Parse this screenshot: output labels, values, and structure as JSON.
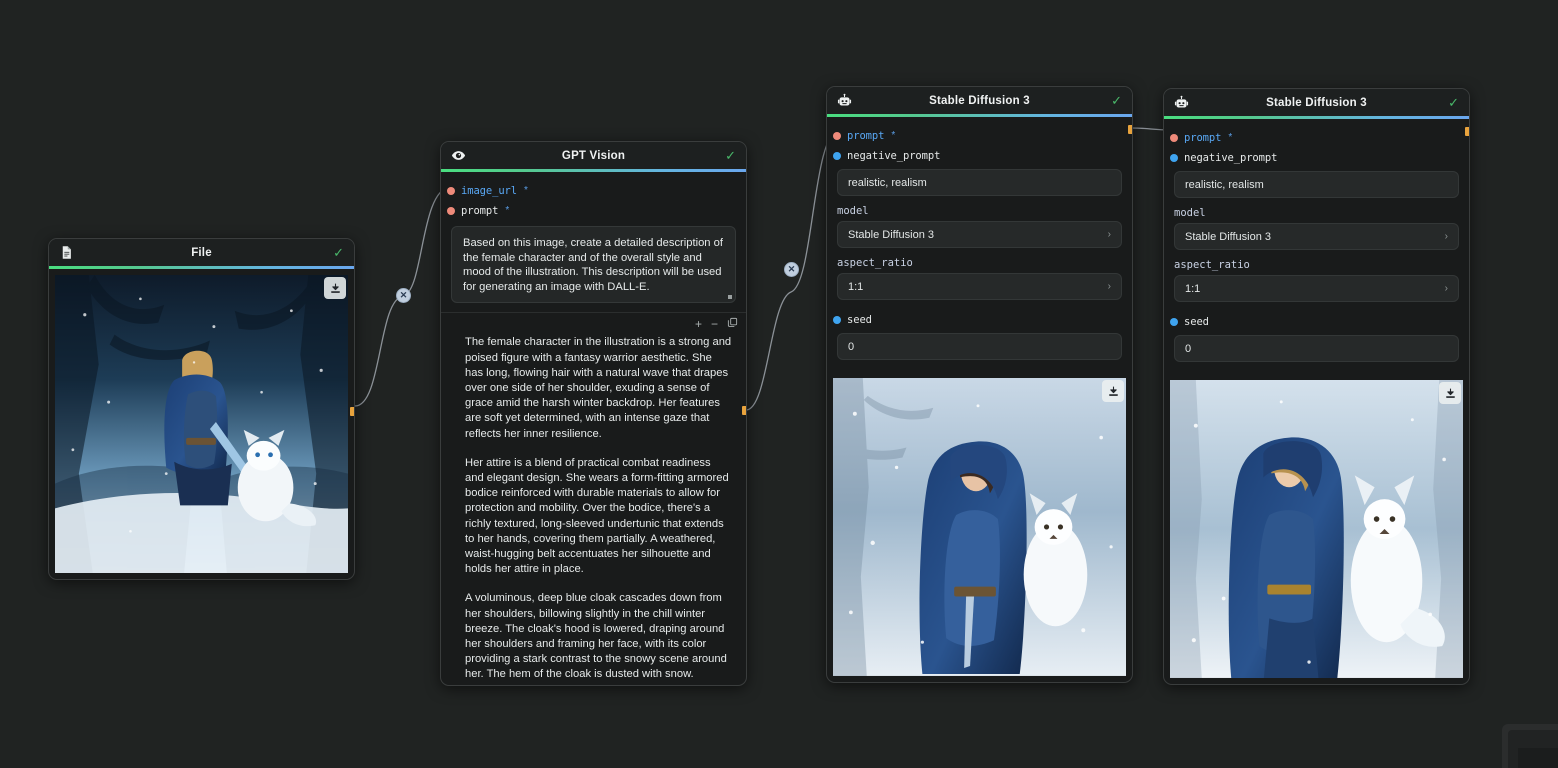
{
  "app": {
    "background_color": "#202322",
    "accent_orange": "#e8a33d",
    "rule_gradient": [
      "#4ade80",
      "#6aa7ee"
    ]
  },
  "nodes": [
    {
      "id": "file",
      "title": "File",
      "icon": "document-icon",
      "status_icon": "check-icon",
      "image_alt": "Fantasy warrior woman in blue cloak with white fox in snowy forest",
      "download_label": "download-icon"
    },
    {
      "id": "gpt_vision",
      "title": "GPT Vision",
      "icon": "eye-icon",
      "status_icon": "check-icon",
      "ports": [
        {
          "name": "image_url",
          "required": true,
          "kind": "required"
        },
        {
          "name": "prompt",
          "required": true,
          "kind": "required"
        }
      ],
      "prompt_value": "Based on this image, create a detailed description of the female character and of the overall style and mood of the illustration. This description will be used for generating an image with DALL-E.",
      "output_tools": [
        "plus-icon",
        "minus-icon",
        "copy-icon"
      ],
      "output_paragraphs": [
        "The female character in the illustration is a strong and poised figure with a fantasy warrior aesthetic. She has long, flowing hair with a natural wave that drapes over one side of her shoulder, exuding a sense of grace amid the harsh winter backdrop. Her features are soft yet determined, with an intense gaze that reflects her inner resilience.",
        "Her attire is a blend of practical combat readiness and elegant design. She wears a form-fitting armored bodice reinforced with durable materials to allow for protection and mobility. Over the bodice, there's a richly textured, long-sleeved undertunic that extends to her hands, covering them partially. A weathered, waist-hugging belt accentuates her silhouette and holds her attire in place.",
        "A voluminous, deep blue cloak cascades down from her shoulders, billowing slightly in the chill winter breeze. The cloak's hood is lowered, draping around her shoulders and framing her face, with its color providing a stark contrast to the snowy scene around her. The hem of the cloak is dusted with snow."
      ]
    },
    {
      "id": "sd3_left",
      "title": "Stable Diffusion 3",
      "icon": "robot-icon",
      "status_icon": "check-icon",
      "ports": [
        {
          "name": "prompt",
          "required": true,
          "kind": "required"
        },
        {
          "name": "negative_prompt",
          "required": false,
          "kind": "optional"
        }
      ],
      "negative_prompt_value": "realistic, realism",
      "fields": [
        {
          "label": "model",
          "value": "Stable Diffusion 3",
          "type": "select"
        },
        {
          "label": "aspect_ratio",
          "value": "1:1",
          "type": "select"
        }
      ],
      "seed_port": {
        "name": "seed",
        "kind": "optional"
      },
      "seed_value": "0",
      "image_alt": "Generated image: dark-haired woman in blue hooded cloak with white fox in snow",
      "download_label": "download-icon"
    },
    {
      "id": "sd3_right",
      "title": "Stable Diffusion 3",
      "icon": "robot-icon",
      "status_icon": "check-icon",
      "ports": [
        {
          "name": "prompt",
          "required": true,
          "kind": "required"
        },
        {
          "name": "negative_prompt",
          "required": false,
          "kind": "optional"
        }
      ],
      "negative_prompt_value": "realistic, realism",
      "fields": [
        {
          "label": "model",
          "value": "Stable Diffusion 3",
          "type": "select"
        },
        {
          "label": "aspect_ratio",
          "value": "1:1",
          "type": "select"
        }
      ],
      "seed_port": {
        "name": "seed",
        "kind": "optional"
      },
      "seed_value": "0",
      "image_alt": "Generated image: blonde woman in blue cloak beside a large white fox in snow",
      "download_label": "download-icon"
    }
  ],
  "edges": [
    {
      "id": "file-to-gptvision",
      "button_label": "✕",
      "button_name": "delete-edge-button"
    },
    {
      "id": "gptvision-to-sd3",
      "button_label": "✕",
      "button_name": "delete-edge-button"
    }
  ],
  "misc": {
    "required_star": "*",
    "chevron": "›",
    "check": "✓",
    "plus": "+",
    "minus": "−"
  }
}
